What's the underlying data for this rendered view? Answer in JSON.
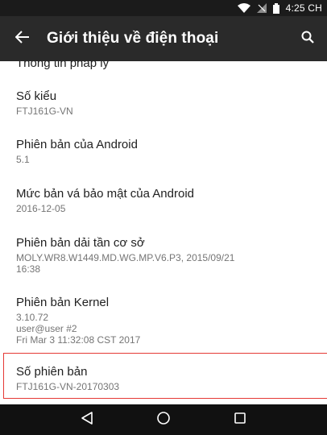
{
  "status_bar": {
    "time": "4:25 CH",
    "icons": [
      "wifi-icon",
      "signal-icon",
      "battery-icon"
    ]
  },
  "app_bar": {
    "title": "Giới thiệu về điện thoại",
    "back_icon": "arrow-left-icon",
    "search_icon": "search-icon"
  },
  "items": [
    {
      "title": "Thông tin pháp lý",
      "summary": []
    },
    {
      "title": "Số kiểu",
      "summary": [
        "FTJ161G-VN"
      ]
    },
    {
      "title": "Phiên bản của Android",
      "summary": [
        "5.1"
      ]
    },
    {
      "title": "Mức bản vá bảo mật của Android",
      "summary": [
        "2016-12-05"
      ]
    },
    {
      "title": "Phiên bản dải tần cơ sở",
      "summary": [
        "MOLY.WR8.W1449.MD.WG.MP.V6.P3, 2015/09/21",
        "16:38"
      ]
    },
    {
      "title": "Phiên bản Kernel",
      "summary": [
        "3.10.72",
        "user@user #2",
        "Fri Mar 3 11:32:08 CST 2017"
      ]
    },
    {
      "title": "Số phiên bản",
      "summary": [
        "FTJ161G-VN-20170303"
      ]
    }
  ],
  "nav_bar": {
    "buttons": [
      "back-triangle-icon",
      "home-circle-icon",
      "recents-square-icon"
    ]
  },
  "colors": {
    "app_bar": "#2a2a2a",
    "status_bar": "#1b1b1b",
    "nav_bar": "#111111",
    "highlight_border": "#e53935"
  }
}
